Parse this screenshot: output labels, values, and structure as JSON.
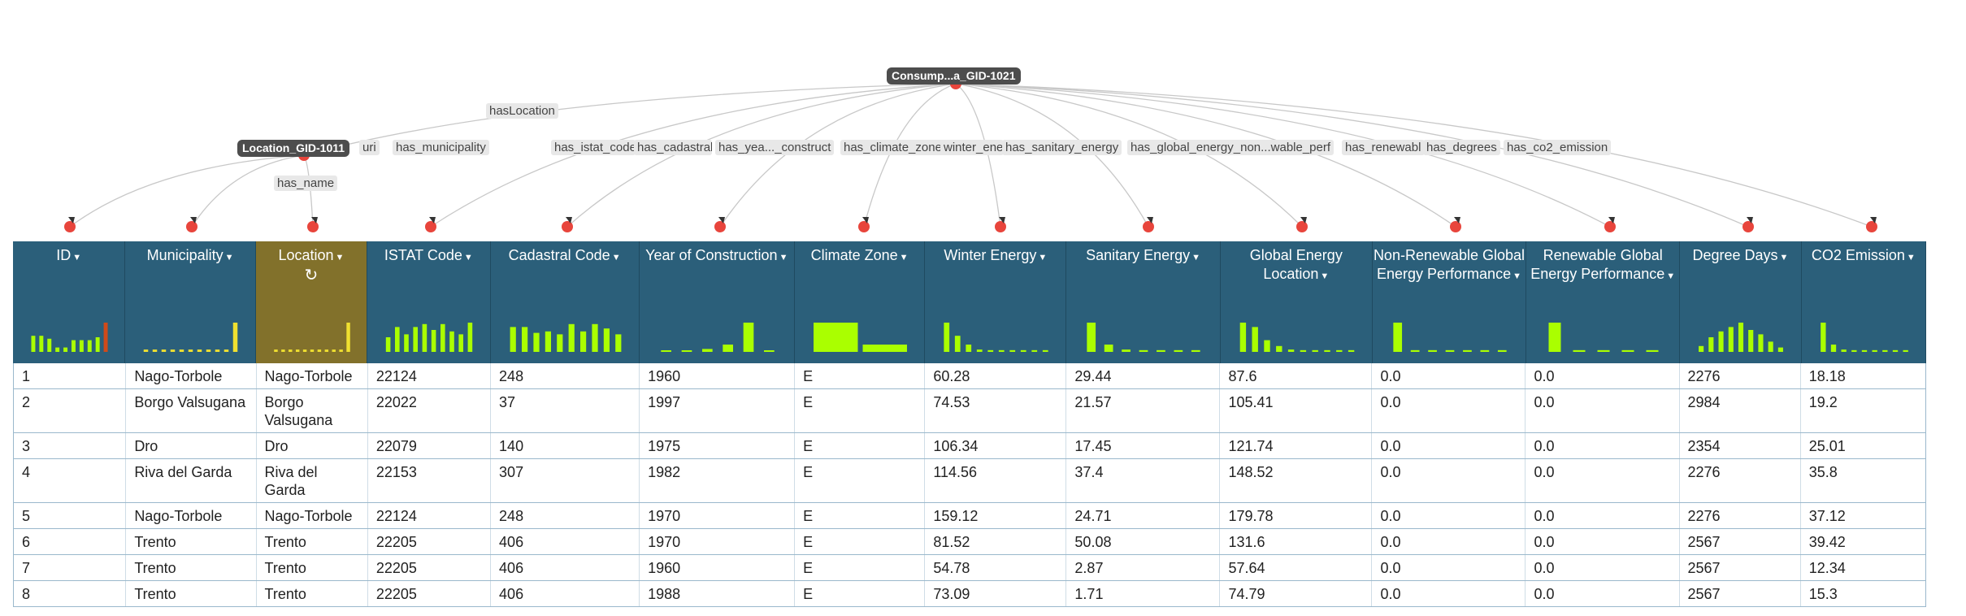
{
  "graph": {
    "root_node": "Consump...a_GID-1021",
    "location_node": "Location_GID-1011",
    "labels": {
      "hasLocation": "hasLocation",
      "uri": "uri",
      "has_municipality": "has_municipality",
      "has_name": "has_name",
      "has_istat_code": "has_istat_code",
      "has_cadastral": "has_cadastral",
      "has_year": "has_yea..._construct",
      "has_climate_zone": "has_climate_zone",
      "winter_energy": "winter_ener",
      "has_sanitary_energy": "has_sanitary_energy",
      "has_global_energy": "has_global_energy_non...wable_perf",
      "has_renewable": "has_renewabl",
      "has_degrees": "has_degrees",
      "has_co2_emission": "has_co2_emission"
    }
  },
  "columns": [
    {
      "label": "ID",
      "selected": false,
      "bars": [
        0.55,
        0.55,
        0.45,
        0.15,
        0.15,
        0.4,
        0.4,
        0.4,
        0.5,
        1.0
      ],
      "highlight_last": true
    },
    {
      "label": "Municipality",
      "selected": false,
      "bars": [
        0.08,
        0.08,
        0.08,
        0.08,
        0.08,
        0.08,
        0.08,
        0.08,
        0.08,
        0.08,
        1.0
      ],
      "highlight_last": true,
      "color": "#f0e030"
    },
    {
      "label": "Location",
      "selected": true,
      "refresh_icon": "refresh-icon",
      "bars": [
        0.08,
        0.08,
        0.08,
        0.08,
        0.08,
        0.08,
        0.08,
        0.08,
        0.08,
        0.08,
        1.0
      ],
      "color": "#f0e030"
    },
    {
      "label": "ISTAT Code",
      "selected": false,
      "bars": [
        0.5,
        0.85,
        0.6,
        0.85,
        0.95,
        0.75,
        0.95,
        0.7,
        0.6,
        1.0
      ]
    },
    {
      "label": "Cadastral Code",
      "selected": false,
      "bars": [
        0.85,
        0.85,
        0.65,
        0.7,
        0.6,
        0.95,
        0.7,
        0.95,
        0.8,
        0.6
      ]
    },
    {
      "label": "Year of Construction",
      "selected": false,
      "bars": [
        0.05,
        0.05,
        0.1,
        0.25,
        1.0,
        0.05
      ]
    },
    {
      "label": "Climate Zone",
      "selected": false,
      "bars": [
        1.0,
        0.25
      ],
      "wide": true
    },
    {
      "label": "Winter Energy",
      "selected": false,
      "bars": [
        1.0,
        0.55,
        0.25,
        0.08,
        0.06,
        0.06,
        0.06,
        0.06,
        0.06,
        0.06
      ]
    },
    {
      "label": "Sanitary Energy",
      "selected": false,
      "bars": [
        1.0,
        0.25,
        0.08,
        0.06,
        0.06,
        0.06,
        0.06
      ]
    },
    {
      "label": "Global Energy Location",
      "selected": false,
      "bars": [
        1.0,
        0.85,
        0.4,
        0.2,
        0.08,
        0.06,
        0.06,
        0.06,
        0.06,
        0.06
      ]
    },
    {
      "label": "Non-Renewable Global Energy Performance",
      "selected": false,
      "bars": [
        1.0,
        0.06,
        0.06,
        0.06,
        0.06,
        0.06,
        0.06
      ]
    },
    {
      "label": "Renewable Global Energy Performance",
      "selected": false,
      "bars": [
        1.0,
        0.06,
        0.06,
        0.06,
        0.06
      ]
    },
    {
      "label": "Degree Days",
      "selected": false,
      "bars": [
        0.2,
        0.5,
        0.7,
        0.85,
        1.0,
        0.75,
        0.6,
        0.35,
        0.15
      ]
    },
    {
      "label": "CO2 Emission",
      "selected": false,
      "bars": [
        1.0,
        0.25,
        0.08,
        0.06,
        0.06,
        0.06,
        0.06,
        0.06,
        0.06
      ]
    }
  ],
  "rows": [
    [
      "1",
      "Nago-Torbole",
      "Nago-Torbole",
      "22124",
      "248",
      "1960",
      "E",
      "60.28",
      "29.44",
      "87.6",
      "0.0",
      "0.0",
      "2276",
      "18.18"
    ],
    [
      "2",
      "Borgo Valsugana",
      "Borgo Valsugana",
      "22022",
      "37",
      "1997",
      "E",
      "74.53",
      "21.57",
      "105.41",
      "0.0",
      "0.0",
      "2984",
      "19.2"
    ],
    [
      "3",
      "Dro",
      "Dro",
      "22079",
      "140",
      "1975",
      "E",
      "106.34",
      "17.45",
      "121.74",
      "0.0",
      "0.0",
      "2354",
      "25.01"
    ],
    [
      "4",
      "Riva del Garda",
      "Riva del Garda",
      "22153",
      "307",
      "1982",
      "E",
      "114.56",
      "37.4",
      "148.52",
      "0.0",
      "0.0",
      "2276",
      "35.8"
    ],
    [
      "5",
      "Nago-Torbole",
      "Nago-Torbole",
      "22124",
      "248",
      "1970",
      "E",
      "159.12",
      "24.71",
      "179.78",
      "0.0",
      "0.0",
      "2276",
      "37.12"
    ],
    [
      "6",
      "Trento",
      "Trento",
      "22205",
      "406",
      "1970",
      "E",
      "81.52",
      "50.08",
      "131.6",
      "0.0",
      "0.0",
      "2567",
      "39.42"
    ],
    [
      "7",
      "Trento",
      "Trento",
      "22205",
      "406",
      "1960",
      "E",
      "54.78",
      "2.87",
      "57.64",
      "0.0",
      "0.0",
      "2567",
      "12.34"
    ],
    [
      "8",
      "Trento",
      "Trento",
      "22205",
      "406",
      "1988",
      "E",
      "73.09",
      "1.71",
      "74.79",
      "0.0",
      "0.0",
      "2567",
      "15.3"
    ]
  ],
  "colors": {
    "header_bg": "#2b5f7a",
    "selected_header_bg": "#82712b",
    "bar": "#aaff00",
    "bar_highlight": "#d04a1a",
    "node_dot": "#e8453c"
  }
}
